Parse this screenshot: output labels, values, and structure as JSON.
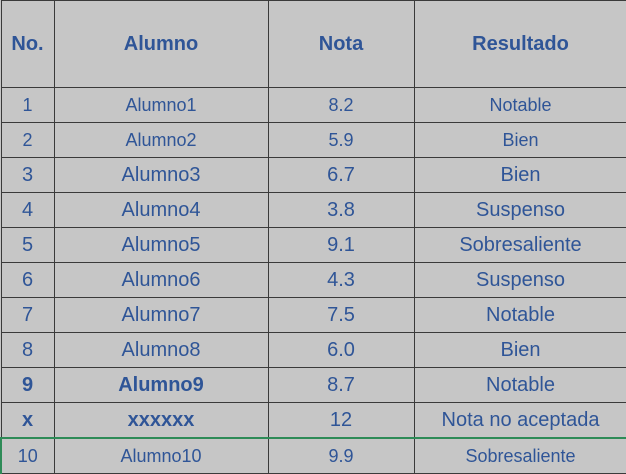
{
  "table": {
    "headers": {
      "no": "No.",
      "alumno": "Alumno",
      "nota": "Nota",
      "resultado": "Resultado"
    },
    "rows": [
      {
        "no": "1",
        "alumno": "Alumno1",
        "nota": "8.2",
        "resultado": "Notable"
      },
      {
        "no": "2",
        "alumno": "Alumno2",
        "nota": "5.9",
        "resultado": "Bien"
      },
      {
        "no": "3",
        "alumno": "Alumno3",
        "nota": "6.7",
        "resultado": "Bien"
      },
      {
        "no": "4",
        "alumno": "Alumno4",
        "nota": "3.8",
        "resultado": "Suspenso"
      },
      {
        "no": "5",
        "alumno": "Alumno5",
        "nota": "9.1",
        "resultado": "Sobresaliente"
      },
      {
        "no": "6",
        "alumno": "Alumno6",
        "nota": "4.3",
        "resultado": "Suspenso"
      },
      {
        "no": "7",
        "alumno": "Alumno7",
        "nota": "7.5",
        "resultado": "Notable"
      },
      {
        "no": "8",
        "alumno": "Alumno8",
        "nota": "6.0",
        "resultado": "Bien"
      },
      {
        "no": "9",
        "alumno": "Alumno9",
        "nota": "8.7",
        "resultado": "Notable"
      },
      {
        "no": "x",
        "alumno": "xxxxxx",
        "nota": "12",
        "resultado": "Nota no aceptada"
      },
      {
        "no": "10",
        "alumno": "Alumno10",
        "nota": "9.9",
        "resultado": "Sobresaliente"
      }
    ]
  },
  "colors": {
    "text": "#2f5597",
    "cell_background": "#c6c6c6",
    "grid": "#3a3a3a",
    "selection_border": "#2e8b57"
  }
}
